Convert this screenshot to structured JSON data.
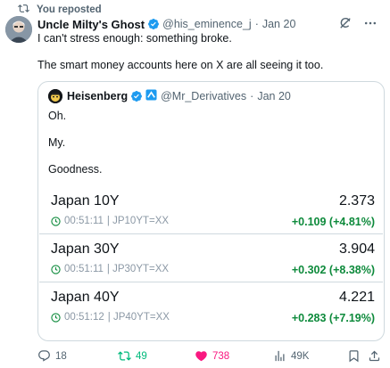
{
  "repost_banner": {
    "text": "You reposted"
  },
  "tweet": {
    "author_name": "Uncle Milty's Ghost",
    "handle": "@his_eminence_j",
    "separator": "·",
    "date": "Jan 20",
    "text_line1": "I can't stress enough: something broke.",
    "text_line2": "The smart money accounts here on X are all seeing it too."
  },
  "quote": {
    "author_name": "Heisenberg",
    "handle": "@Mr_Derivatives",
    "separator": "·",
    "date": "Jan 20",
    "lines": [
      "Oh.",
      "My.",
      "Goodness."
    ],
    "rows": [
      {
        "name": "Japan 10Y",
        "price": "2.373",
        "time": "00:51:11",
        "ticker": "| JP10YT=XX",
        "change": "+0.109 (+4.81%)"
      },
      {
        "name": "Japan 30Y",
        "price": "3.904",
        "time": "00:51:11",
        "ticker": "| JP30YT=XX",
        "change": "+0.302 (+8.38%)"
      },
      {
        "name": "Japan 40Y",
        "price": "4.221",
        "time": "00:51:12",
        "ticker": "| JP40YT=XX",
        "change": "+0.283 (+7.19%)"
      }
    ]
  },
  "actions": {
    "replies": "18",
    "reposts": "49",
    "likes": "738",
    "views": "49K"
  },
  "colors": {
    "accent": "#1d9bf0",
    "positive": "#0d8a3b",
    "repost_active": "#00ba7c",
    "like_active": "#f91880",
    "muted": "#536471",
    "border": "#cfd9de"
  },
  "icons": {
    "repost_banner": "repost-icon",
    "verified": "verified-badge-icon",
    "grok": "grok-icon",
    "more": "more-icon",
    "clock": "clock-icon",
    "reply": "reply-icon",
    "repost": "repost-icon",
    "like": "heart-icon",
    "views": "views-icon",
    "bookmark": "bookmark-icon",
    "share": "share-icon"
  }
}
